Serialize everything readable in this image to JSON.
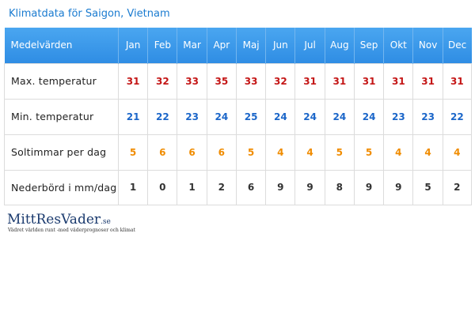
{
  "page": {
    "title": "Klimatdata för Saigon, Vietnam"
  },
  "table": {
    "header_label": "Medelvärden",
    "months": [
      "Jan",
      "Feb",
      "Mar",
      "Apr",
      "Maj",
      "Jun",
      "Jul",
      "Aug",
      "Sep",
      "Okt",
      "Nov",
      "Dec"
    ],
    "rows": [
      {
        "label": "Max. temperatur",
        "values": [
          "31",
          "32",
          "33",
          "35",
          "33",
          "32",
          "31",
          "31",
          "31",
          "31",
          "31",
          "31"
        ]
      },
      {
        "label": "Min. temperatur",
        "values": [
          "21",
          "22",
          "23",
          "24",
          "25",
          "24",
          "24",
          "24",
          "24",
          "23",
          "23",
          "22"
        ]
      },
      {
        "label": "Soltimmar per dag",
        "values": [
          "5",
          "6",
          "6",
          "6",
          "5",
          "4",
          "4",
          "5",
          "5",
          "4",
          "4",
          "4"
        ]
      },
      {
        "label": "Nederbörd i mm/dag",
        "values": [
          "1",
          "0",
          "1",
          "2",
          "6",
          "9",
          "9",
          "8",
          "9",
          "9",
          "5",
          "2"
        ]
      }
    ]
  },
  "colors": {
    "header_bg": "#3a97e8",
    "title": "#1a7bd0",
    "max_temp": "#c41616",
    "min_temp": "#1b66c9",
    "sun_hours": "#f08c00",
    "precipitation": "#333333"
  },
  "footer": {
    "logo_name": "MittResVader",
    "logo_tld": ".se",
    "tagline": "Vädret världen runt -med väderprognoser och klimat"
  }
}
